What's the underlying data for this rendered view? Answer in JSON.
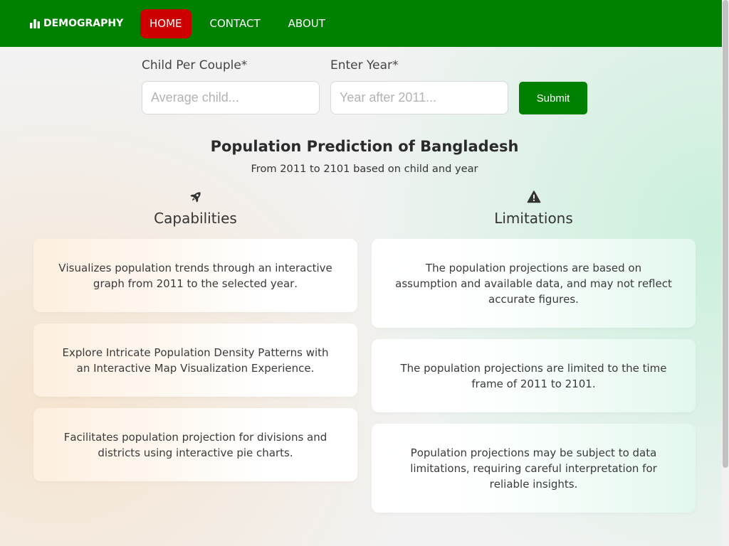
{
  "theme": {
    "nav_bg": "#008000",
    "active_bg": "#cc0000",
    "submit_bg": "#008000"
  },
  "nav": {
    "brand": "DEMOGRAPHY",
    "brand_icon": "bar-chart-icon",
    "items": [
      {
        "label": "HOME",
        "active": true
      },
      {
        "label": "CONTACT",
        "active": false
      },
      {
        "label": "ABOUT",
        "active": false
      }
    ]
  },
  "form": {
    "child_label": "Child Per Couple*",
    "child_placeholder": "Average child...",
    "child_value": "",
    "year_label": "Enter Year*",
    "year_placeholder": "Year after 2011...",
    "year_value": "",
    "submit_label": "Submit"
  },
  "hero": {
    "title": "Population Prediction of Bangladesh",
    "subtitle": "From 2011 to 2101 based on child and year"
  },
  "capabilities": {
    "icon": "rocket-icon",
    "heading": "Capabilities",
    "cards": [
      "Visualizes population trends through an interactive graph from 2011 to the selected year.",
      "Explore Intricate Population Density Patterns with an Interactive Map Visualization Experience.",
      "Facilitates population projection for divisions and districts using interactive pie charts."
    ]
  },
  "limitations": {
    "icon": "warning-icon",
    "heading": "Limitations",
    "cards": [
      "The population projections are based on assumption and available data, and may not reflect accurate figures.",
      "The population projections are limited to the time frame of 2011 to 2101.",
      "Population projections may be subject to data limitations, requiring careful interpretation for reliable insights."
    ]
  }
}
